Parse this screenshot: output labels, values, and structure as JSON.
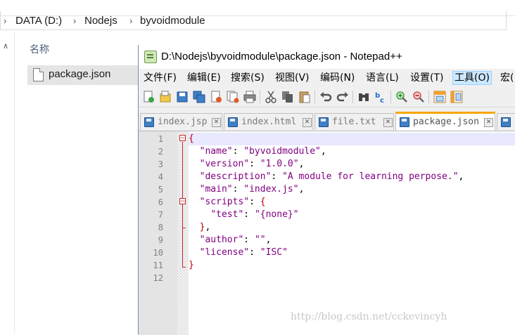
{
  "explorer": {
    "breadcrumb": [
      "DATA (D:)",
      "Nodejs",
      "byvoidmodule"
    ],
    "column_header": "名称",
    "file_name": "package.json"
  },
  "npp": {
    "title": "D:\\Nodejs\\byvoidmodule\\package.json - Notepad++",
    "menu": [
      "文件(F)",
      "编辑(E)",
      "搜索(S)",
      "视图(V)",
      "编码(N)",
      "语言(L)",
      "设置(T)",
      "工具(O)",
      "宏("
    ],
    "toolbar_icons": [
      "new-file-icon",
      "open-file-icon",
      "save-icon",
      "save-all-icon",
      "close-icon",
      "close-all-icon",
      "print-icon",
      "cut-icon",
      "copy-icon",
      "paste-icon",
      "undo-icon",
      "redo-icon",
      "find-icon",
      "replace-icon",
      "zoom-in-icon",
      "zoom-out-icon",
      "sync-vertical-icon",
      "sync-horizontal-icon"
    ],
    "tabs": [
      {
        "label": "index.jsp"
      },
      {
        "label": "index.html"
      },
      {
        "label": "file.txt"
      },
      {
        "label": "package.json"
      }
    ],
    "line_numbers": [
      "1",
      "2",
      "3",
      "4",
      "5",
      "6",
      "7",
      "8",
      "9",
      "10",
      "11",
      "12"
    ],
    "code": {
      "l1": "{",
      "l2_key": "\"name\"",
      "l2_colon": ": ",
      "l2_val": "\"byvoidmodule\"",
      "l2_comma": ",",
      "l3_key": "\"version\"",
      "l3_colon": ": ",
      "l3_val": "\"1.0.0\"",
      "l3_comma": ",",
      "l4_key": "\"description\"",
      "l4_colon": ": ",
      "l4_val": "\"A module for learning perpose.\"",
      "l4_comma": ",",
      "l5_key": "\"main\"",
      "l5_colon": ": ",
      "l5_val": "\"index.js\"",
      "l5_comma": ",",
      "l6_key": "\"scripts\"",
      "l6_colon": ": ",
      "l6_brace": "{",
      "l7_key": "\"test\"",
      "l7_colon": ": ",
      "l7_val": "\"{none}\"",
      "l8_brace": "}",
      "l8_comma": ",",
      "l9_key": "\"author\"",
      "l9_colon": ": ",
      "l9_val": "\"\"",
      "l9_comma": ",",
      "l10_key": "\"license\"",
      "l10_colon": ": ",
      "l10_val": "\"ISC\"",
      "l11": "}"
    }
  },
  "watermark": "http://blog.csdn.net/cckevincyh",
  "colors": {
    "brace": "#c00000",
    "string": "#800080",
    "active_tab": "#f7a600"
  }
}
